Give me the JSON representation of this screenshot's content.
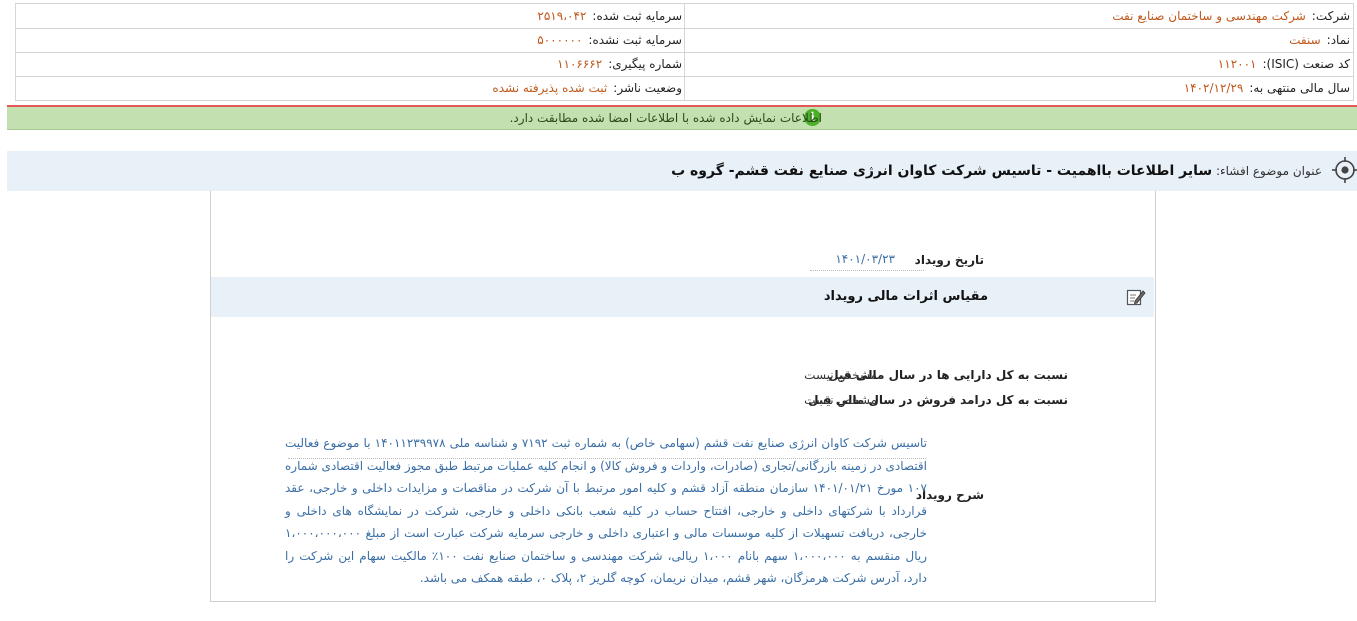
{
  "header": {
    "company_label": "شرکت:",
    "company_value": "شرکت مهندسی و ساختمان صنایع نفت",
    "symbol_label": "نماد:",
    "symbol_value": "سنفت",
    "isic_label": "کد صنعت (ISIC):",
    "isic_value": "۱۱۲۰۰۱",
    "fiscal_label": "سال مالی منتهی به:",
    "fiscal_value": "۱۴۰۲/۱۲/۲۹",
    "reg_capital_label": "سرمایه ثبت شده:",
    "reg_capital_value": "۲۵۱۹،۰۴۲",
    "unreg_capital_label": "سرمایه ثبت نشده:",
    "unreg_capital_value": "۵۰۰۰۰۰۰",
    "tracking_label": "شماره پیگیری:",
    "tracking_value": "۱۱۰۶۶۶۲",
    "publisher_status_label": "وضعیت ناشر:",
    "publisher_status_value": "ثبت شده پذیرفته نشده"
  },
  "notice": {
    "icon": "info-icon",
    "text": "اطلاعات نمایش داده شده با اطلاعات امضا شده مطابقت دارد."
  },
  "subject": {
    "icon": "target-icon",
    "label": "عنوان موضوع افشاء:",
    "value": "سایر اطلاعات بااهمیت - تاسیس شرکت کاوان انرژی صنایع نفت قشم- گروه ب"
  },
  "event": {
    "date_label": "تاریخ رویداد",
    "date_value": "۱۴۰۱/۰۳/۲۳"
  },
  "impact": {
    "icon": "edit-icon",
    "title": "مقیاس اثرات مالی رویداد",
    "asset_label": "نسبت به کل دارایی ها در سال مالی قبل",
    "asset_value": "مشخص نیست",
    "revenue_label": "نسبت به کل درامد فروش در سال مالی قبل",
    "revenue_value": "مشخص نیست"
  },
  "description": {
    "label": "شرح رویداد",
    "text": "تاسیس شرکت کاوان انرژی صنایع نفت قشم (سهامی خاص) به شماره ثبت ۷۱۹۲ و شناسه ملی ۱۴۰۱۱۲۳۹۹۷۸ با موضوع فعالیت اقتصادی در زمینه بازرگانی/تجاری (صادرات، واردات و فروش کالا) و انجام کلیه عملیات مرتبط طبق مجوز فعالیت اقتصادی شماره ۱۰۷ مورخ ۱۴۰۱/۰۱/۲۱ سازمان منطقه آزاد قشم و کلیه امور مرتبط با آن شرکت در مناقصات و مزایدات داخلی و خارجی، عقد قرارداد با شرکتهای داخلی و خارجی، افتتاح حساب در کلیه شعب بانکی داخلی و خارجی، شرکت در نمایشگاه های داخلی و خارجی، دریافت تسهیلات از کلیه موسسات مالی و اعتباری داخلی و خارجی سرمایه شرکت عبارت است از مبلغ ۱،۰۰۰،۰۰۰،۰۰۰ ریال منقسم به ۱،۰۰۰،۰۰۰ سهم بانام ۱،۰۰۰ ریالی، شرکت مهندسی و ساختمان صنایع نفت ۱۰۰٪ مالکیت سهام این شرکت را دارد، آدرس شرکت هرمزگان، شهر قشم، میدان نریمان، کوچه گلریز ۲، پلاک ۰، طبقه همکف می باشد."
  }
}
